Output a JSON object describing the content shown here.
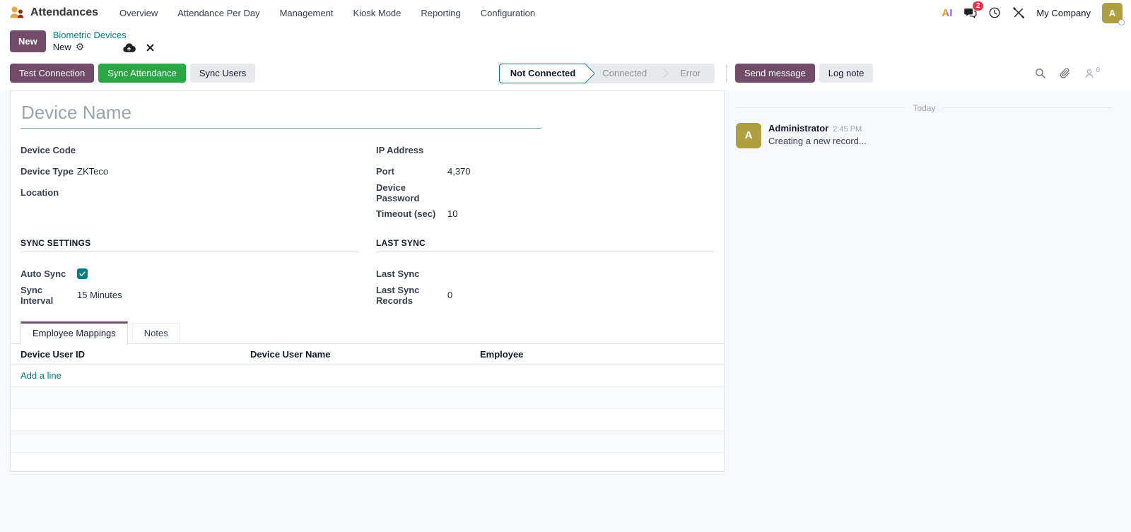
{
  "navbar": {
    "app_name": "Attendances",
    "menus": [
      "Overview",
      "Attendance Per Day",
      "Management",
      "Kiosk Mode",
      "Reporting",
      "Configuration"
    ],
    "messages_badge": "2",
    "company": "My Company",
    "avatar_initial": "A",
    "ai_label": "AI"
  },
  "breadcrumb": {
    "new_button": "New",
    "parent": "Biometric Devices",
    "current": "New"
  },
  "actions": {
    "test_connection": "Test Connection",
    "sync_attendance": "Sync Attendance",
    "sync_users": "Sync Users",
    "send_message": "Send message",
    "log_note": "Log note",
    "followers_count": "0"
  },
  "statusbar": {
    "steps": [
      {
        "label": "Not Connected"
      },
      {
        "label": "Connected"
      },
      {
        "label": "Error"
      }
    ]
  },
  "form": {
    "name_placeholder": "Device Name",
    "fields_left": [
      {
        "label": "Device Code",
        "value": ""
      },
      {
        "label": "Device Type",
        "value": "ZKTeco"
      },
      {
        "label": "Location",
        "value": ""
      }
    ],
    "fields_right": [
      {
        "label": "IP Address",
        "value": ""
      },
      {
        "label": "Port",
        "value": "4,370"
      },
      {
        "label": "Device Password",
        "value": ""
      },
      {
        "label": "Timeout (sec)",
        "value": "10"
      }
    ],
    "sync_section_title": "SYNC SETTINGS",
    "auto_sync_label": "Auto Sync",
    "auto_sync_checked": true,
    "sync_interval_label": "Sync Interval",
    "sync_interval_value": "15 Minutes",
    "last_sync_section_title": "LAST SYNC",
    "last_sync_label": "Last Sync",
    "last_sync_value": "",
    "last_sync_records_label": "Last Sync Records",
    "last_sync_records_value": "0",
    "tabs": [
      {
        "label": "Employee Mappings"
      },
      {
        "label": "Notes"
      }
    ],
    "table_headers": [
      "Device User ID",
      "Device User Name",
      "Employee"
    ],
    "add_line": "Add a line"
  },
  "chatter": {
    "date_divider": "Today",
    "message": {
      "author": "Administrator",
      "time": "2:45 PM",
      "body": "Creating a new record...",
      "avatar_initial": "A"
    }
  },
  "colors": {
    "primary_purple": "#714B67",
    "accent_teal": "#017E84",
    "success_green": "#28a745",
    "avatar_olive": "#AEA041",
    "badge_red": "#DC3545"
  }
}
